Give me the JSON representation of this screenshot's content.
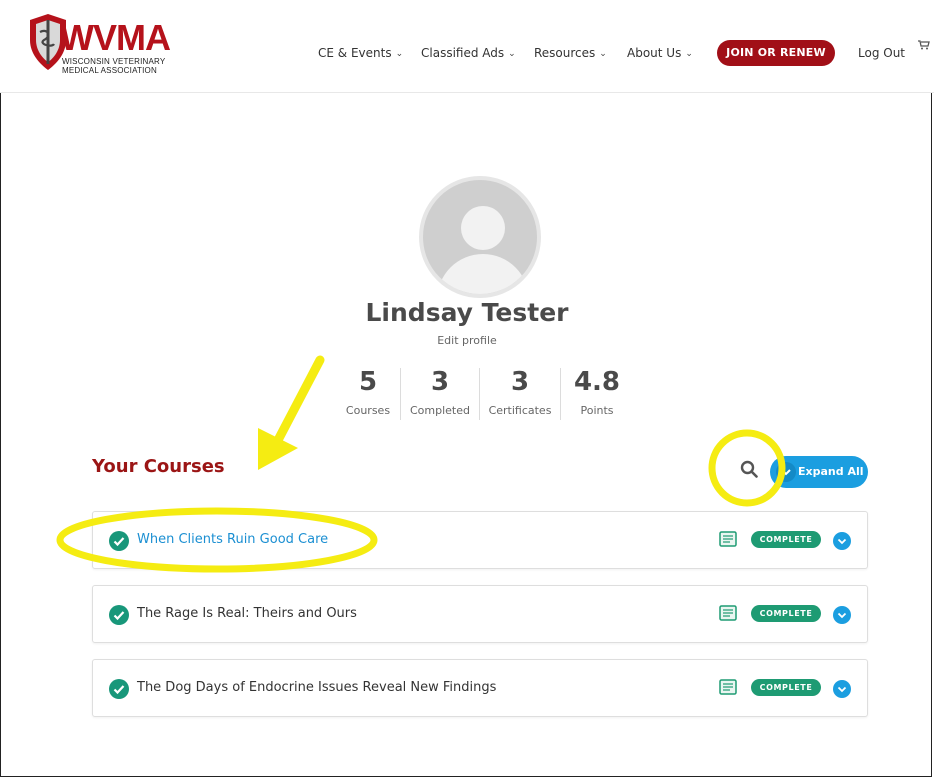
{
  "header": {
    "logo": {
      "wordmark": "WVMA",
      "line1": "WISCONSIN VETERINARY",
      "line2": "MEDICAL ASSOCIATION"
    },
    "nav": [
      {
        "label": "CE & Events"
      },
      {
        "label": "Classified Ads"
      },
      {
        "label": "Resources"
      },
      {
        "label": "About Us"
      }
    ],
    "join_label": "JOIN OR RENEW",
    "logout_label": "Log Out"
  },
  "profile": {
    "name": "Lindsay Tester",
    "edit_label": "Edit profile",
    "stats": [
      {
        "value": "5",
        "label": "Courses"
      },
      {
        "value": "3",
        "label": "Completed"
      },
      {
        "value": "3",
        "label": "Certificates"
      },
      {
        "value": "4.8",
        "label": "Points"
      }
    ]
  },
  "courses": {
    "title": "Your Courses",
    "expand_label": "Expand All",
    "items": [
      {
        "title": "When Clients Ruin Good Care",
        "status": "COMPLETE"
      },
      {
        "title": "The Rage Is Real: Theirs and Ours",
        "status": "COMPLETE"
      },
      {
        "title": "The Dog Days of Endocrine Issues Reveal New Findings",
        "status": "COMPLETE"
      }
    ]
  },
  "colors": {
    "brand_red": "#a10f17",
    "accent_blue": "#1b9ee0",
    "complete_green": "#1e9b73",
    "annotation_yellow": "#f5ec12"
  }
}
